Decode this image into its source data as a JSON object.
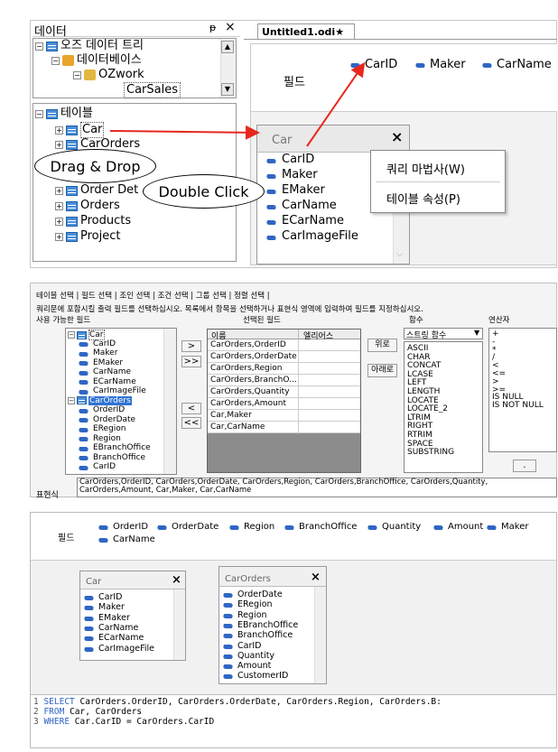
{
  "p1": {
    "left_title": "데이터",
    "pin": "ᵽ",
    "close": "×",
    "tree_top": [
      "오즈 데이터 트리",
      "데이터베이스",
      "OZwork",
      "CarSales"
    ],
    "tree_tables": {
      "root": "테이블",
      "items": [
        "Car",
        "CarOrders",
        "Order Det",
        "Orders",
        "Products",
        "Project"
      ]
    },
    "tab": "Untitled1.odi",
    "field_label": "필드",
    "fields": [
      "CarID",
      "Maker",
      "CarName"
    ],
    "car_box": {
      "title": "Car",
      "close": "×",
      "items": [
        "CarID",
        "Maker",
        "EMaker",
        "CarName",
        "ECarName",
        "CarImageFile"
      ]
    },
    "menu": [
      "쿼리 마법사(W)",
      "테이블 속성(P)"
    ],
    "callouts": [
      "Drag & Drop",
      "Double Click"
    ]
  },
  "p2": {
    "tabs": "테이블 선택 | 필드 선택 | 조인 선택 | 조건 선택 | 그룹 선택 | 정렬 선택 |",
    "instruction": "쿼리문에 포함시킬 출력 필드를 선택하십시오. 목록에서 항목을 선택하거나 표현식 영역에 입력하여 필드를 지정하십시오.",
    "headers": [
      "사용 가능한 필드",
      "선택된 필드",
      "함수",
      "연산자"
    ],
    "tree": [
      {
        "t": "table",
        "label": "Car"
      },
      {
        "t": "f",
        "label": "CarID"
      },
      {
        "t": "f",
        "label": "Maker"
      },
      {
        "t": "f",
        "label": "EMaker"
      },
      {
        "t": "f",
        "label": "CarName"
      },
      {
        "t": "f",
        "label": "ECarName"
      },
      {
        "t": "f",
        "label": "CarImageFile"
      },
      {
        "t": "table",
        "label": "CarOrders"
      },
      {
        "t": "f",
        "label": "OrderID"
      },
      {
        "t": "f",
        "label": "OrderDate"
      },
      {
        "t": "f",
        "label": "ERegion"
      },
      {
        "t": "f",
        "label": "Region"
      },
      {
        "t": "f",
        "label": "EBranchOffice"
      },
      {
        "t": "f",
        "label": "BranchOffice"
      },
      {
        "t": "f",
        "label": "CarID"
      }
    ],
    "arrows": [
      ">",
      ">>",
      "<",
      "<<"
    ],
    "grid_headers": [
      "이름",
      "엘리어스"
    ],
    "grid_rows": [
      "CarOrders,OrderID",
      "CarOrders,OrderDate",
      "CarOrders,Region",
      "CarOrders,BranchO...",
      "CarOrders,Quantity",
      "CarOrders,Amount",
      "Car,Maker",
      "Car,CarName"
    ],
    "up": "위로",
    "down": "아래로",
    "func_select": "스트링 함수",
    "funcs": [
      "ASCII",
      "CHAR",
      "CONCAT",
      "LCASE",
      "LEFT",
      "LENGTH",
      "LOCATE",
      "LOCATE_2",
      "LTRIM",
      "RIGHT",
      "RTRIM",
      "SPACE",
      "SUBSTRING"
    ],
    "operators": [
      "+",
      "-",
      "*",
      "/",
      "<",
      "<=",
      ">",
      ">=",
      "IS NULL",
      "IS NOT NULL"
    ],
    "dot": ".",
    "expr_label": "표현식",
    "expr": [
      "CarOrders,OrderID, CarOrders,OrderDate, CarOrders,Region, CarOrders,BranchOffice, CarOrders,Quantity,",
      "CarOrders,Amount, Car,Maker, Car,CarName"
    ]
  },
  "p3": {
    "field_label": "필드",
    "fields": [
      "OrderID",
      "OrderDate",
      "Region",
      "BranchOffice",
      "Quantity",
      "Amount",
      "Maker",
      "CarName"
    ],
    "car": {
      "title": "Car",
      "close": "×",
      "items": [
        "CarID",
        "Maker",
        "EMaker",
        "CarName",
        "ECarName",
        "CarImageFile"
      ]
    },
    "orders": {
      "title": "CarOrders",
      "close": "×",
      "items": [
        "OrderDate",
        "ERegion",
        "Region",
        "EBranchOffice",
        "BranchOffice",
        "CarID",
        "Quantity",
        "Amount",
        "CustomerID"
      ]
    },
    "sql": [
      {
        "n": "1",
        "kw": "SELECT",
        "rest": " CarOrders.OrderID, CarOrders.OrderDate, CarOrders.Region, CarOrders.B:"
      },
      {
        "n": "2",
        "kw": "FROM",
        "rest": " Car, CarOrders"
      },
      {
        "n": "3",
        "kw": "WHERE",
        "rest": " Car.CarID = CarOrders.CarID"
      }
    ]
  }
}
